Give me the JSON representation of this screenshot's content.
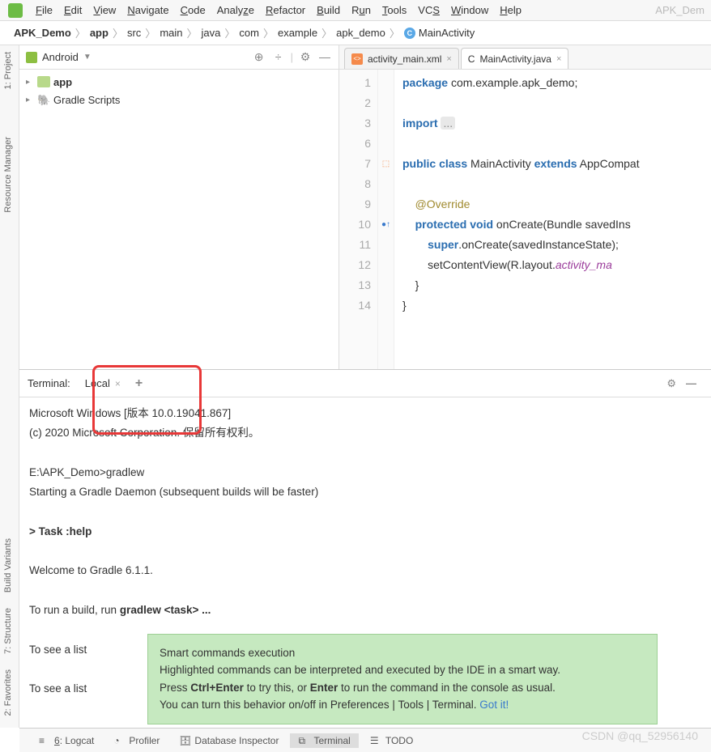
{
  "menubar": {
    "items": [
      "File",
      "Edit",
      "View",
      "Navigate",
      "Code",
      "Analyze",
      "Refactor",
      "Build",
      "Run",
      "Tools",
      "VCS",
      "Window",
      "Help"
    ],
    "dim": "APK_Dem"
  },
  "breadcrumb": {
    "segs": [
      "APK_Demo",
      "app",
      "src",
      "main",
      "java",
      "com",
      "example",
      "apk_demo"
    ],
    "last": "MainActivity"
  },
  "project": {
    "mode": "Android",
    "app": "app",
    "gradle": "Gradle Scripts"
  },
  "left_tabs": {
    "project": "1: Project",
    "resmgr": "Resource Manager",
    "build": "Build Variants",
    "struct": "7: Structure",
    "fav": "2: Favorites"
  },
  "editor": {
    "tab1": "activity_main.xml",
    "tab2": "MainActivity.java",
    "lines": {
      "l1a": "package",
      "l1b": "com.example.apk_demo;",
      "l3a": "import",
      "l3b": "...",
      "l7a": "public class",
      "l7b": "MainActivity",
      "l7c": "extends",
      "l7d": "AppCompat",
      "l9": "@Override",
      "l10a": "protected void",
      "l10b": "onCreate",
      "l10c": "(Bundle savedIns",
      "l11a": "super",
      "l11b": ".onCreate(savedInstanceState);",
      "l12a": "setContentView(R.layout.",
      "l12b": "activity_ma",
      "l13": "}",
      "l14": "}"
    },
    "gutterNums": [
      "1",
      "2",
      "3",
      "6",
      "7",
      "8",
      "9",
      "10",
      "11",
      "12",
      "13",
      "14"
    ]
  },
  "terminal": {
    "header": "Terminal:",
    "tab": "Local",
    "lines": {
      "l1": "Microsoft Windows [版本 10.0.19041.867]",
      "l2": "(c) 2020 Microsoft Corporation. 保留所有权利。",
      "l4": "E:\\APK_Demo>gradlew",
      "l5": "Starting a Gradle Daemon (subsequent builds will be faster)",
      "l7a": "> Task :help",
      "l9": "Welcome to Gradle 6.1.1.",
      "l11a": "To run a build, run ",
      "l11b": "gradlew <task> ...",
      "l13": "To see a list",
      "l15": "To see a list"
    }
  },
  "tooltip": {
    "title": "Smart commands execution",
    "line2": "Highlighted commands can be interpreted and executed by the IDE in a smart way.",
    "line3a": "Press ",
    "line3b": "Ctrl+Enter",
    "line3c": " to try this, or ",
    "line3d": "Enter",
    "line3e": " to run the command in the console as usual.",
    "line4a": "You can turn this behavior on/off in Preferences | Tools | Terminal. ",
    "gotit": "Got it!"
  },
  "bottom": {
    "logcat": "6: Logcat",
    "profiler": "Profiler",
    "db": "Database Inspector",
    "terminal": "Terminal",
    "todo": "TODO"
  },
  "watermark": "CSDN @qq_52956140"
}
